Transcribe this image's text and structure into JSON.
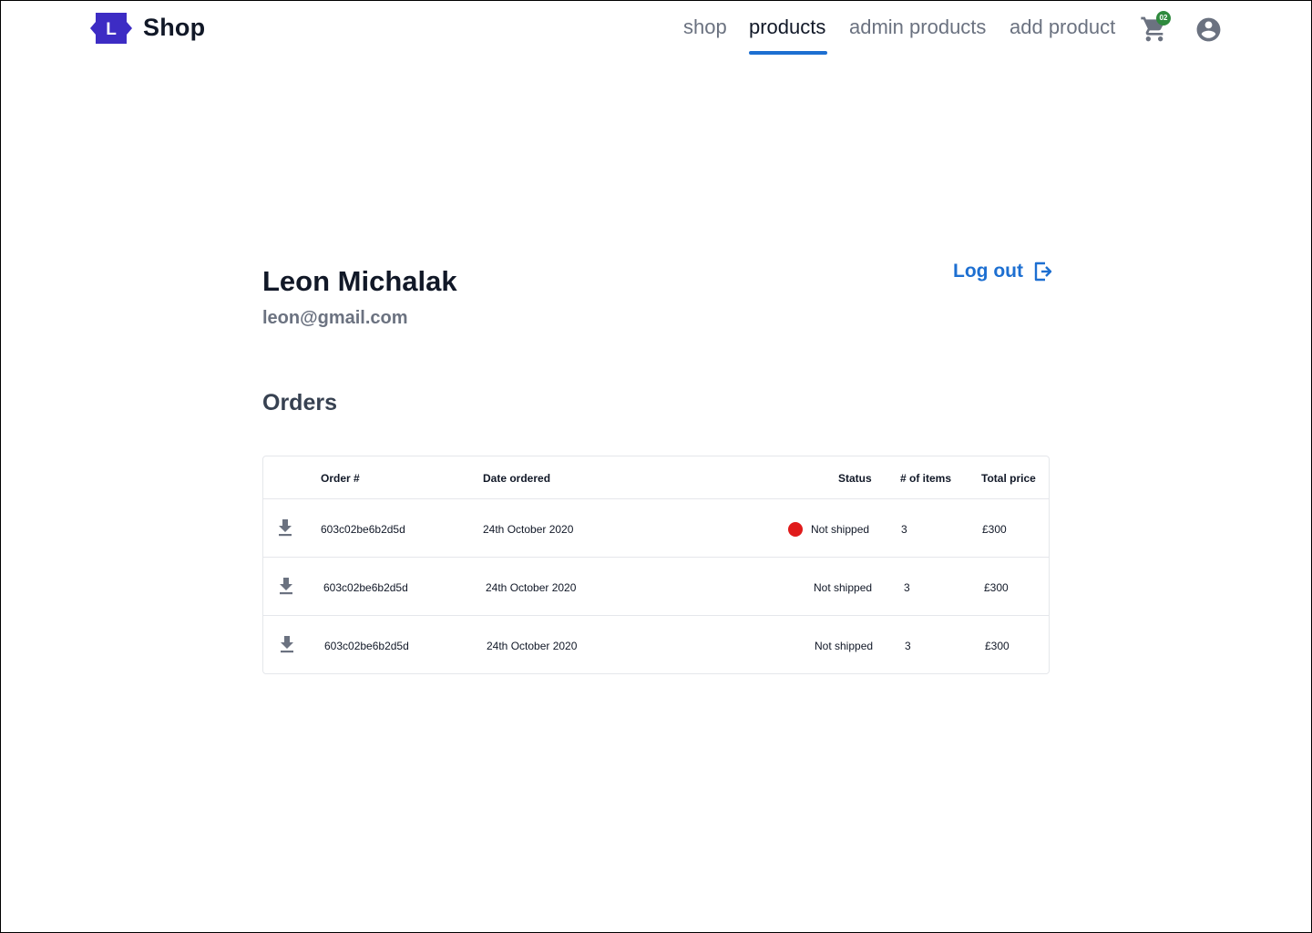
{
  "brand": {
    "letter": "L",
    "name": "Shop",
    "color": "#3d2cc4"
  },
  "nav": {
    "items": [
      {
        "label": "shop",
        "active": false
      },
      {
        "label": "products",
        "active": true
      },
      {
        "label": "admin products",
        "active": false
      },
      {
        "label": "add product",
        "active": false
      }
    ],
    "cart_count": "02",
    "accent": "#1d6fd1"
  },
  "profile": {
    "name": "Leon Michalak",
    "email": "leon@gmail.com",
    "logout_label": "Log out"
  },
  "orders": {
    "heading": "Orders",
    "columns": {
      "order": "Order #",
      "date": "Date ordered",
      "status": "Status",
      "items": "# of items",
      "total": "Total price"
    },
    "rows": [
      {
        "order_id": "603c02be6b2d5d",
        "date": "24th October 2020",
        "status": "Not shipped",
        "status_color": "#e01b1b",
        "items": "3",
        "total": "£300"
      },
      {
        "order_id": "603c02be6b2d5d",
        "date": "24th October 2020",
        "status": "Not shipped",
        "status_color": "",
        "items": "3",
        "total": "£300"
      },
      {
        "order_id": "603c02be6b2d5d",
        "date": "24th October 2020",
        "status": "Not shipped",
        "status_color": "",
        "items": "3",
        "total": "£300"
      }
    ]
  },
  "icons": {
    "logo": "bookmark-logo-icon",
    "cart": "shopping-cart-icon",
    "avatar": "account-circle-icon",
    "logout": "logout-icon",
    "download": "download-icon"
  }
}
